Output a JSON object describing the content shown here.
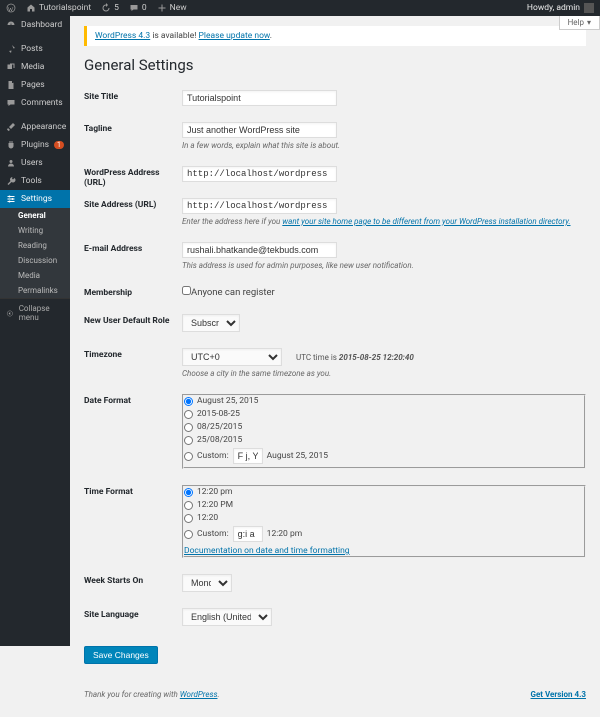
{
  "adminbar": {
    "site": "Tutorialspoint",
    "updates": "5",
    "comments": "0",
    "new": "New",
    "howdy": "Howdy, admin"
  },
  "sidebar": {
    "dashboard": "Dashboard",
    "posts": "Posts",
    "media": "Media",
    "pages": "Pages",
    "comments": "Comments",
    "appearance": "Appearance",
    "plugins": "Plugins",
    "plugins_badge": "1",
    "users": "Users",
    "tools": "Tools",
    "settings": "Settings",
    "sub": {
      "general": "General",
      "writing": "Writing",
      "reading": "Reading",
      "discussion": "Discussion",
      "media": "Media",
      "permalinks": "Permalinks"
    },
    "collapse": "Collapse menu"
  },
  "help": "Help",
  "notice": {
    "p1": "WordPress 4.3",
    "p2": " is available! ",
    "p3": "Please update now",
    "p4": "."
  },
  "h1": "General Settings",
  "labels": {
    "site_title": "Site Title",
    "tagline": "Tagline",
    "wp_url": "WordPress Address (URL)",
    "site_url": "Site Address (URL)",
    "email": "E-mail Address",
    "membership": "Membership",
    "default_role": "New User Default Role",
    "timezone": "Timezone",
    "date_format": "Date Format",
    "time_format": "Time Format",
    "week_starts": "Week Starts On",
    "language": "Site Language"
  },
  "values": {
    "site_title": "Tutorialspoint",
    "tagline": "Just another WordPress site",
    "wp_url": "http://localhost/wordpress",
    "site_url": "http://localhost/wordpress",
    "email": "rushali.bhatkande@tekbuds.com",
    "default_role": "Subscriber",
    "timezone": "UTC+0",
    "date_custom": "F j, Y",
    "date_custom_preview": "August 25, 2015",
    "time_custom": "g:i a",
    "time_custom_preview": "12:20 pm",
    "week_starts": "Monday",
    "language": "English (United States)"
  },
  "desc": {
    "tagline": "In a few words, explain what this site is about.",
    "siteurl_a": "Enter the address here if you ",
    "siteurl_b": "want your site home page to be different from your WordPress installation directory.",
    "email": "This address is used for admin purposes, like new user notification.",
    "timezone": "Choose a city in the same timezone as you.",
    "utc_prefix": "UTC time is ",
    "utc_ts": "2015-08-25 12:20:40"
  },
  "membership_cb": "Anyone can register",
  "date_opts": [
    "August 25, 2015",
    "2015-08-25",
    "08/25/2015",
    "25/08/2015"
  ],
  "time_opts": [
    "12:20 pm",
    "12:20 PM",
    "12:20"
  ],
  "custom_label": "Custom:",
  "doc_link": "Documentation on date and time formatting",
  "save": "Save Changes",
  "footer": {
    "a": "Thank you for creating with ",
    "b": "WordPress",
    "c": ".",
    "ver": "Get Version 4.3"
  }
}
